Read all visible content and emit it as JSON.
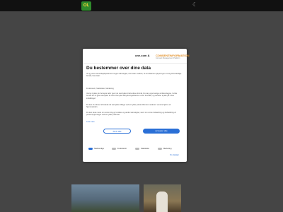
{
  "header": {
    "logo_text": "OL",
    "theme_icon": "moon-icon"
  },
  "modal": {
    "brand": "one.com",
    "brand_sep": "&",
    "partner": "CONSENTINFORMATION",
    "partner_sub": "Consent Management Platform",
    "title": "Du bestemmer over dine data",
    "intro": "Vi og vores samarbejdspartnere bruger teknologier, herunder cookies, til at indsamle oplysninger om dig til forskellige formål, herunder:",
    "purposes": "Funktionelt, Statistiske, Marketing",
    "paragraph1": "Ved at trykke på 'Accepter alle' giver du samtykke til alle disse formål. Du kan også vælge at tilkendegive, hvilke formål du vil give samtykke til ved at benytte afkrydsningsfelterne ud for formålet, og derefter trykke på 'Gem indstillinger'.",
    "paragraph2": "Du kan til enhver tid trække dit samtykke tilbage ved at trykke på det lille ikon nederst i venstre hjørne af hjemmesiden.",
    "paragraph3": "Du kan læse mere om vores brug af cookies og andre teknologier, samt om vores indsamling og behandling af personoplysninger ved at trykke på linket.",
    "more_link": "Læs mere",
    "deny_label": "Afvis alle",
    "accept_label": "Accepter alle",
    "categories": [
      "Nødvendige",
      "Funktionelt",
      "Statistiske",
      "Marketing"
    ],
    "details_link": "Vis detaljer",
    "accent_color": "#2a6fd6"
  }
}
